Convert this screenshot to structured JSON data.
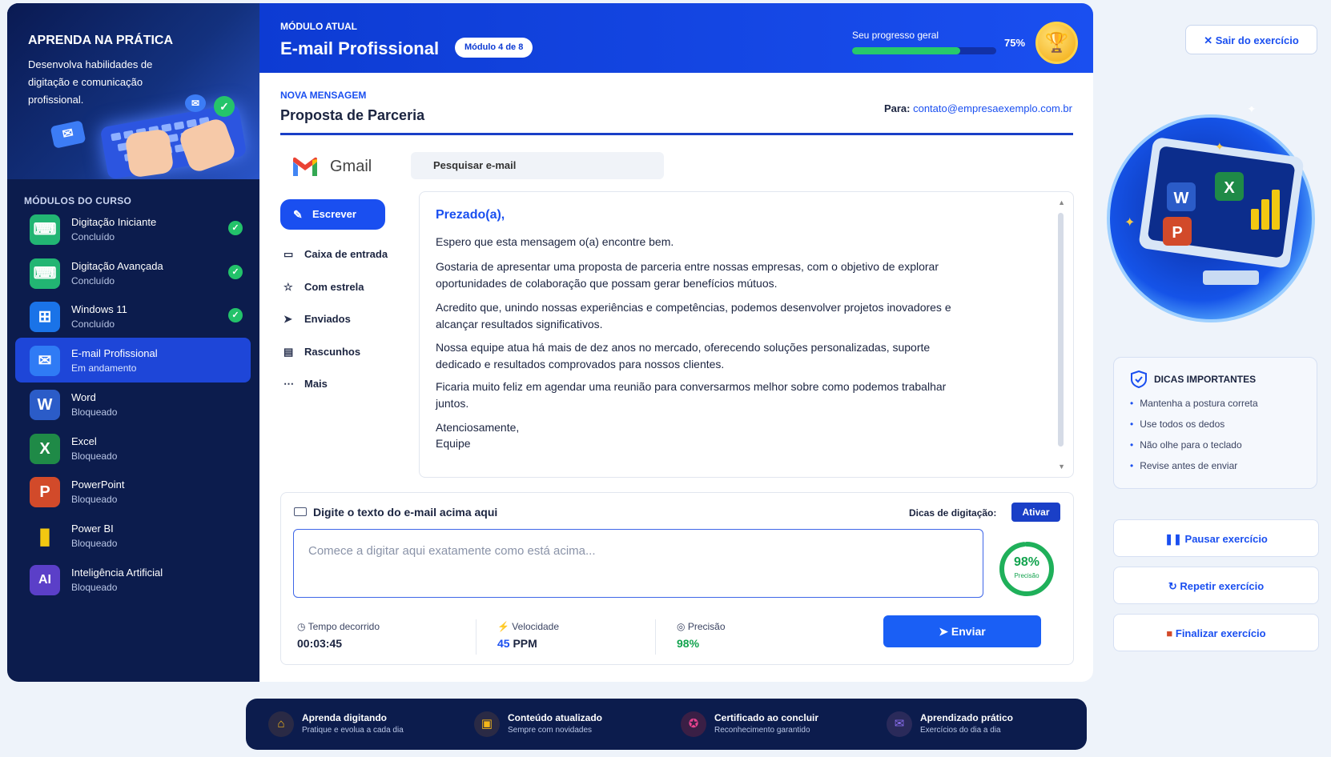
{
  "sidebar": {
    "hero_title": "APRENDA NA PRÁTICA",
    "hero_desc": "Desenvolva habilidades de digitação e comunicação profissional.",
    "modules_label": "MÓDULOS DO CURSO",
    "modules": [
      {
        "name": "Digitação Iniciante",
        "status": "Concluído",
        "icon": "keyboard-icon",
        "color": "#22b573",
        "done": true
      },
      {
        "name": "Digitação Avançada",
        "status": "Concluído",
        "icon": "keyboard-icon",
        "color": "#22b573",
        "done": true
      },
      {
        "name": "Windows 11",
        "status": "Concluído",
        "icon": "windows-icon",
        "color": "#1a73e8",
        "done": true
      },
      {
        "name": "E-mail Profissional",
        "status": "Em andamento",
        "icon": "email-icon",
        "color": "#2f7bf5",
        "done": false
      },
      {
        "name": "Word",
        "status": "Bloqueado",
        "icon": "word-icon",
        "glyph": "W",
        "color": "#2b5cc8",
        "done": false
      },
      {
        "name": "Excel",
        "status": "Bloqueado",
        "icon": "excel-icon",
        "glyph": "X",
        "color": "#1f8a47",
        "done": false
      },
      {
        "name": "PowerPoint",
        "status": "Bloqueado",
        "icon": "powerpoint-icon",
        "glyph": "P",
        "color": "#d24a2a",
        "done": false
      },
      {
        "name": "Power BI",
        "status": "Bloqueado",
        "icon": "powerbi-icon",
        "color": "#f2c811",
        "done": false
      },
      {
        "name": "Inteligência Artificial",
        "status": "Bloqueado",
        "icon": "ai-icon",
        "glyph": "AI",
        "color": "#5b3fc8",
        "done": false
      }
    ]
  },
  "header": {
    "label": "MÓDULO ATUAL",
    "title": "E-mail Profissional",
    "badge": "Módulo 4 de 8",
    "progress_label": "Seu progresso geral",
    "progress_value": "75%",
    "progress_fraction": 0.75
  },
  "message": {
    "label": "NOVA MENSAGEM",
    "title": "Proposta de Parceria",
    "to_label": "Para:",
    "to_address": "contato@empresaexemplo.com.br"
  },
  "gmail": {
    "brand": "Gmail",
    "search_placeholder": "Pesquisar e-mail",
    "compose": "Escrever",
    "nav": [
      {
        "label": "Caixa de entrada",
        "icon": "inbox-icon"
      },
      {
        "label": "Com estrela",
        "icon": "star-icon"
      },
      {
        "label": "Enviados",
        "icon": "send-icon"
      },
      {
        "label": "Rascunhos",
        "icon": "draft-icon"
      },
      {
        "label": "Mais",
        "icon": "more-icon"
      }
    ]
  },
  "email_body": {
    "greeting": "Prezado(a),",
    "paragraphs": [
      "Espero que esta mensagem o(a) encontre bem.",
      "Gostaria de apresentar uma proposta de parceria entre nossas empresas, com o objetivo de explorar oportunidades de colaboração que possam gerar benefícios mútuos.",
      "Acredito que, unindo nossas experiências e competências, podemos desenvolver projetos inovadores e alcançar resultados significativos.",
      "Nossa equipe atua há mais de dez anos no mercado, oferecendo soluções personalizadas, suporte dedicado e resultados comprovados para nossos clientes.",
      "Ficaria muito feliz em agendar uma reunião para conversarmos melhor sobre como podemos trabalhar juntos."
    ],
    "closing": "Atenciosamente,",
    "signature": "Equipe"
  },
  "typing": {
    "title": "Digite o texto do e-mail acima aqui",
    "tips_label": "Dicas de digitação:",
    "tips_button": "Ativar",
    "placeholder": "Comece a digitar aqui exatamente como está acima...",
    "precision_value": "98%",
    "precision_label": "Precisão",
    "precision_fraction": 0.98,
    "stats": {
      "time_label": "Tempo decorrido",
      "time_value": "00:03:45",
      "speed_label": "Velocidade",
      "speed_number": "45",
      "speed_unit": "PPM",
      "precision_label": "Precisão",
      "precision_value": "98%"
    },
    "send": "Enviar"
  },
  "right": {
    "exit": "Sair do exercício",
    "tips_title": "DICAS IMPORTANTES",
    "tips": [
      "Mantenha a postura correta",
      "Use todos os dedos",
      "Não olhe para o teclado",
      "Revise antes de enviar"
    ],
    "pause": "Pausar exercício",
    "repeat": "Repetir exercício",
    "finish": "Finalizar exercício"
  },
  "footer": [
    {
      "title": "Aprenda digitando",
      "sub": "Pratique e evolua a cada dia",
      "icon": "home-icon",
      "color": "#f2b51a"
    },
    {
      "title": "Conteúdo atualizado",
      "sub": "Sempre com novidades",
      "icon": "clipboard-icon",
      "color": "#f2b51a"
    },
    {
      "title": "Certificado ao concluir",
      "sub": "Reconhecimento garantido",
      "icon": "certificate-icon",
      "color": "#e8438f"
    },
    {
      "title": "Aprendizado prático",
      "sub": "Exercícios do dia a dia",
      "icon": "practice-icon",
      "color": "#8b6ff0"
    }
  ],
  "colors": {
    "primary": "#1a4ff0",
    "dark": "#0c1c4d",
    "success": "#23c26a"
  }
}
